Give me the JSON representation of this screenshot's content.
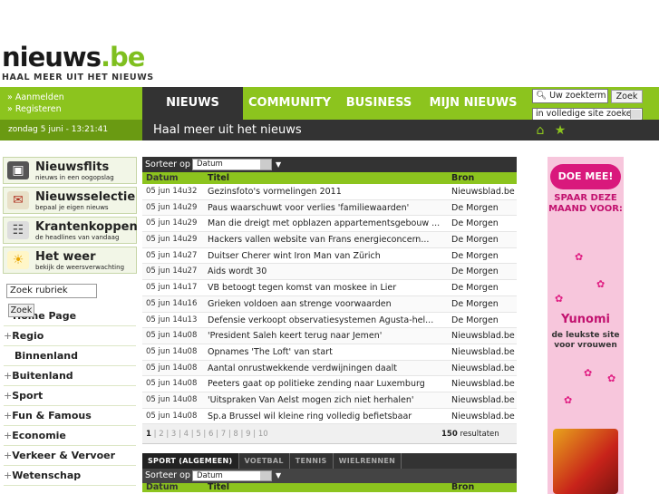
{
  "logo": {
    "main": "nieuws",
    "dot": ".",
    "tld": "be",
    "tagline": "HAAL MEER UIT HET NIEUWS"
  },
  "user_links": {
    "login": "» Aanmelden",
    "register": "» Registeren"
  },
  "nav": [
    {
      "label": "NIEUWS",
      "active": true
    },
    {
      "label": "COMMUNITY",
      "active": false
    },
    {
      "label": "BUSINESS",
      "active": false
    },
    {
      "label": "MIJN NIEUWS",
      "active": false
    }
  ],
  "search": {
    "value": "Uw zoekterm",
    "button": "Zoek",
    "scope": "in volledige site zoeke"
  },
  "datetime": "zondag 5 juni - 13:21:41",
  "band_title": "Haal meer uit het nieuws",
  "band_icons": [
    "home-icon",
    "star-icon"
  ],
  "sidebar": {
    "features": [
      {
        "title": "Nieuwsflits",
        "sub": "nieuws in een oogopslag",
        "icon": "camera-icon"
      },
      {
        "title": "Nieuwsselectie",
        "sub": "bepaal je eigen nieuws",
        "icon": "envelope-icon"
      },
      {
        "title": "Krantenkoppen",
        "sub": "de headlines van vandaag",
        "icon": "newspaper-icon"
      },
      {
        "title": "Het weer",
        "sub": "bekijk de weersverwachting",
        "icon": "sun-cloud-icon"
      }
    ],
    "rubriek_input": "Zoek rubriek",
    "rubriek_button": "Zoek",
    "categories": [
      {
        "plus": "",
        "label": "Home Page"
      },
      {
        "plus": "+",
        "label": "Regio"
      },
      {
        "plus": "",
        "label": "Binnenland"
      },
      {
        "plus": "+",
        "label": "Buitenland"
      },
      {
        "plus": "+",
        "label": "Sport"
      },
      {
        "plus": "+",
        "label": "Fun & Famous"
      },
      {
        "plus": "+",
        "label": "Economie"
      },
      {
        "plus": "+",
        "label": "Verkeer & Vervoer"
      },
      {
        "plus": "+",
        "label": "Wetenschap"
      }
    ]
  },
  "news": {
    "sort_label": "Sorteer op",
    "sort_value": "Datum",
    "columns": [
      "Datum",
      "Titel",
      "Bron"
    ],
    "rows": [
      {
        "date": "05 jun 14u32",
        "title": "Gezinsfoto's vormelingen 2011",
        "source": "Nieuwsblad.be"
      },
      {
        "date": "05 jun 14u29",
        "title": "Paus waarschuwt voor verlies 'familiewaarden'",
        "source": "De Morgen"
      },
      {
        "date": "05 jun 14u29",
        "title": "Man die dreigt met opblazen appartementsgebouw ...",
        "source": "De Morgen"
      },
      {
        "date": "05 jun 14u29",
        "title": "Hackers vallen website van Frans energieconcern...",
        "source": "De Morgen"
      },
      {
        "date": "05 jun 14u27",
        "title": "Duitser Cherer wint Iron Man van Zürich",
        "source": "De Morgen"
      },
      {
        "date": "05 jun 14u27",
        "title": "Aids wordt 30",
        "source": "De Morgen"
      },
      {
        "date": "05 jun 14u17",
        "title": "VB betoogt tegen komst van moskee in Lier",
        "source": "De Morgen"
      },
      {
        "date": "05 jun 14u16",
        "title": "Grieken voldoen aan strenge voorwaarden",
        "source": "De Morgen"
      },
      {
        "date": "05 jun 14u13",
        "title": "Defensie verkoopt observatiesystemen Agusta-hel...",
        "source": "De Morgen"
      },
      {
        "date": "05 jun 14u08",
        "title": "'President Saleh keert terug naar Jemen'",
        "source": "Nieuwsblad.be"
      },
      {
        "date": "05 jun 14u08",
        "title": "Opnames 'The Loft' van start",
        "source": "Nieuwsblad.be"
      },
      {
        "date": "05 jun 14u08",
        "title": "Aantal onrustwekkende verdwijningen daalt",
        "source": "Nieuwsblad.be"
      },
      {
        "date": "05 jun 14u08",
        "title": "Peeters gaat op politieke zending naar Luxemburg",
        "source": "Nieuwsblad.be"
      },
      {
        "date": "05 jun 14u08",
        "title": "'Uitspraken Van Aelst mogen zich niet herhalen'",
        "source": "Nieuwsblad.be"
      },
      {
        "date": "05 jun 14u08",
        "title": "Sp.a Brussel wil kleine ring volledig befietsbaar",
        "source": "Nieuwsblad.be"
      }
    ],
    "pages": [
      "1",
      "2",
      "3",
      "4",
      "5",
      "6",
      "7",
      "8",
      "9",
      "10"
    ],
    "result_count": "150",
    "result_label": "resultaten"
  },
  "sport": {
    "tabs": [
      {
        "label": "SPORT (ALGEMEEN)",
        "active": true
      },
      {
        "label": "VOETBAL",
        "active": false
      },
      {
        "label": "TENNIS",
        "active": false
      },
      {
        "label": "WIELRENNEN",
        "active": false
      }
    ],
    "sort_label": "Sorteer op",
    "sort_value": "Datum",
    "columns": [
      "Datum",
      "Titel",
      "Bron"
    ]
  },
  "ad": {
    "badge": "DOE MEE!",
    "slogan": "SPAAR DEZE MAAND VOOR:",
    "brand": "Yunomi",
    "sub": "de leukste site voor vrouwen"
  },
  "colors": {
    "brand_green": "#8cc41e",
    "dark": "#333333",
    "ad_pink": "#f7c6dc",
    "ad_magenta": "#d9187c"
  }
}
